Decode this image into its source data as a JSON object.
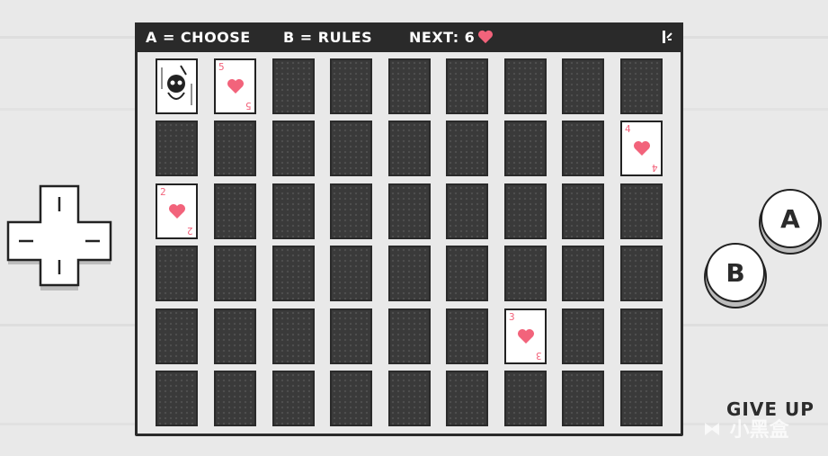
{
  "hud": {
    "choose_label": "A = CHOOSE",
    "rules_label": "B = RULES",
    "next_label": "NEXT: 6",
    "corner_icon": "pause-icon"
  },
  "cards": {
    "skull_card": {
      "suit": "skull-icon"
    },
    "face_cards": [
      {
        "row": 1,
        "col": 2,
        "value": "5"
      },
      {
        "row": 2,
        "col": 9,
        "value": "4"
      },
      {
        "row": 3,
        "col": 1,
        "value": "2"
      },
      {
        "row": 5,
        "col": 7,
        "value": "3"
      }
    ]
  },
  "controls": {
    "a_button": "A",
    "b_button": "B",
    "give_up": "GIVE UP"
  },
  "colors": {
    "heart": "#f2637b",
    "card_back": "#3a3a3a",
    "frame": "#2a2a2a"
  },
  "watermark": "小黑盒"
}
